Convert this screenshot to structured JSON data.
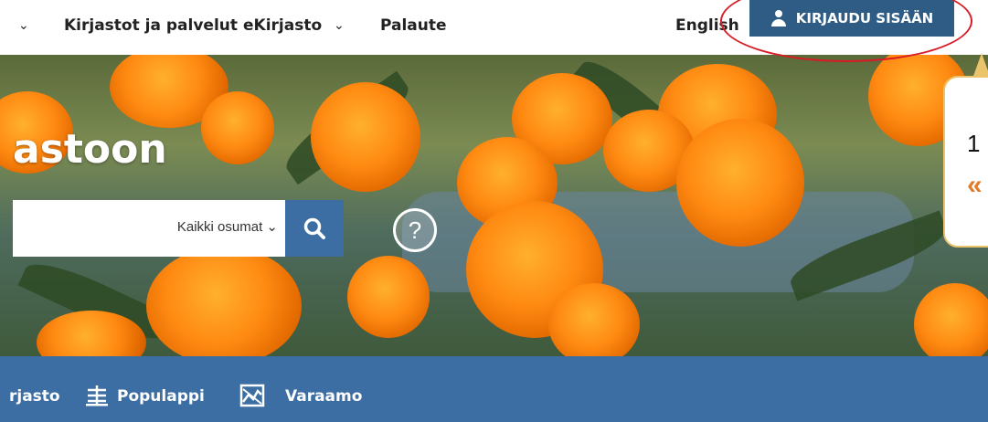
{
  "topnav": {
    "items": [
      {
        "label": "Kirjastot ja palvelut"
      },
      {
        "label": "eKirjasto"
      },
      {
        "label": "Palaute"
      }
    ],
    "language_link": "English",
    "login_button": "KIRJAUDU SISÄÄN"
  },
  "hero": {
    "title": "astoon",
    "search": {
      "scope_label": "Kaikki osumat"
    },
    "help_symbol": "?"
  },
  "callout": {
    "number_text": "1",
    "quote_text": "«"
  },
  "bottomnav": {
    "items": [
      {
        "label": "rjasto"
      },
      {
        "label": "Populappi",
        "icon": "populappi-icon"
      },
      {
        "label": "Varaamo",
        "icon": "varaamo-icon"
      }
    ]
  },
  "colors": {
    "login_button": "#2f5c85",
    "bottom_bar": "#3c6ea3",
    "highlight_ellipse": "#d81b25",
    "callout_border": "#ebc36a",
    "callout_quote": "#e07c2c"
  }
}
